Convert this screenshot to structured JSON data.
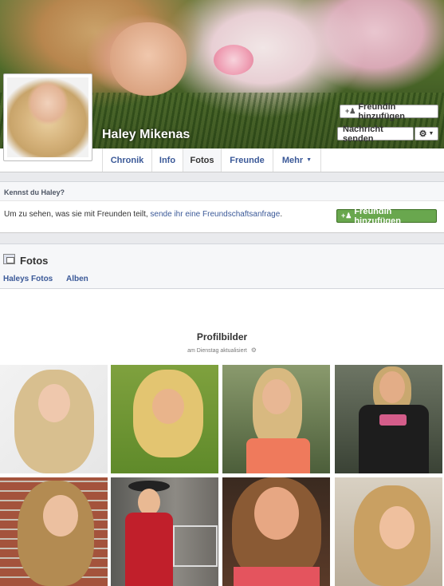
{
  "profile": {
    "name": "Haley Mikenas",
    "add_friend_label": "Freundin hinzufügen",
    "message_label": "Nachricht senden"
  },
  "tabs": [
    {
      "label": "Chronik"
    },
    {
      "label": "Info"
    },
    {
      "label": "Fotos"
    },
    {
      "label": "Freunde"
    },
    {
      "label": "Mehr"
    }
  ],
  "know_box": {
    "title": "Kennst du Haley?",
    "text_prefix": "Um zu sehen, was sie mit Freunden teilt, ",
    "link_text": "sende ihr eine Freundschaftsanfrage",
    "text_suffix": ".",
    "button_label": "Freundin hinzufügen"
  },
  "photos": {
    "title": "Fotos",
    "links": [
      "Haleys Fotos",
      "Alben"
    ]
  },
  "album": {
    "title": "Profilbilder",
    "subtitle": "am Dienstag aktualisiert"
  },
  "colors": {
    "link": "#3b5998",
    "green_button": "#69a74e",
    "band": "#e9eaed"
  },
  "icons": [
    "add-friend-icon",
    "gear-icon",
    "chevron-down-icon",
    "photos-icon"
  ]
}
